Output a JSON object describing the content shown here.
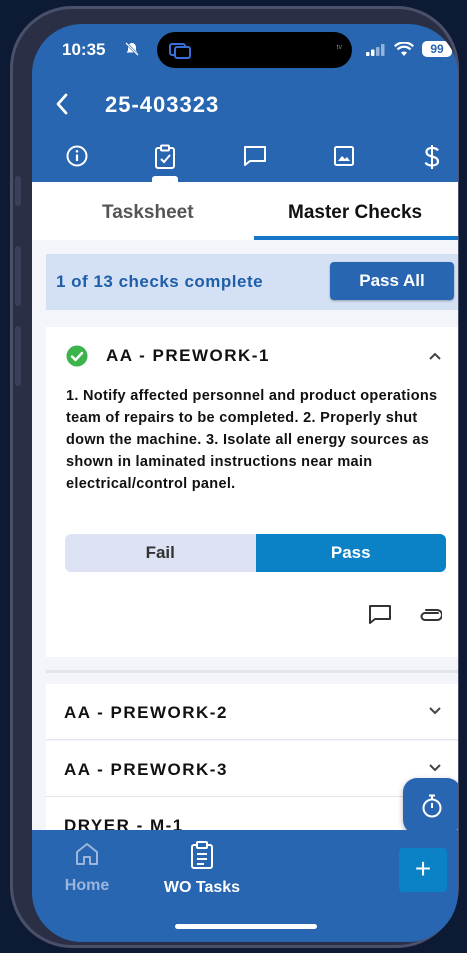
{
  "status_bar": {
    "time": "10:35",
    "battery": "99",
    "island_label": "tv"
  },
  "header": {
    "title": "25-403323"
  },
  "toolbar_icons": [
    "info-icon",
    "clipboard-check-icon",
    "comment-icon",
    "image-icon",
    "dollar-icon"
  ],
  "tabs": {
    "tasksheet": "Tasksheet",
    "master_checks": "Master Checks",
    "active": "master_checks"
  },
  "summary": {
    "text": "1 of 13 checks complete",
    "pass_all_label": "Pass All"
  },
  "checks": [
    {
      "title": "AA - PREWORK-1",
      "status": "passed",
      "expanded": true,
      "instructions": "1. Notify affected personnel and product operations team of repairs to be completed.  2. Properly shut down the machine.  3. Isolate all energy sources as shown in laminated instructions near main electrical/control panel.",
      "fail_label": "Fail",
      "pass_label": "Pass",
      "selected": "pass"
    },
    {
      "title": "AA - PREWORK-2",
      "expanded": false
    },
    {
      "title": "AA - PREWORK-3",
      "expanded": false
    },
    {
      "title": "DRYER - M-1",
      "expanded": false
    }
  ],
  "bottom_nav": {
    "home_label": "Home",
    "tasks_label": "WO Tasks",
    "add_label": "+"
  },
  "colors": {
    "brand_blue": "#2866b1",
    "accent_blue": "#0b82c6",
    "success_green": "#3cb44b",
    "summary_bg": "#d4e1f5"
  }
}
